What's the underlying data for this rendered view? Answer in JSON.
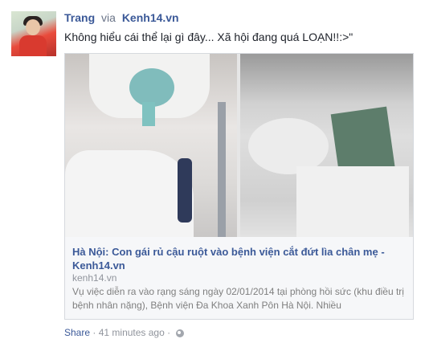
{
  "post": {
    "author": "Trang",
    "via_label": "via",
    "via_source": "Kenh14.vn",
    "status_text": "Không hiểu cái thể lại gì đây... Xã hội đang quá LOẠN!!:>\""
  },
  "link": {
    "title": "Hà Nội: Con gái rủ cậu ruột vào bệnh viện cắt đứt lìa chân mẹ - Kenh14.vn",
    "domain": "kenh14.vn",
    "description": "Vụ việc diễn ra vào rạng sáng ngày 02/01/2014 tại phòng hồi sức (khu điều trị bệnh nhân nặng), Bệnh viện Đa Khoa Xanh Pôn Hà Nội. Nhiều"
  },
  "footer": {
    "share_label": "Share",
    "separator": "·",
    "time": "41 minutes ago",
    "separator2": "·"
  },
  "icons": {
    "privacy": "globe-icon"
  }
}
